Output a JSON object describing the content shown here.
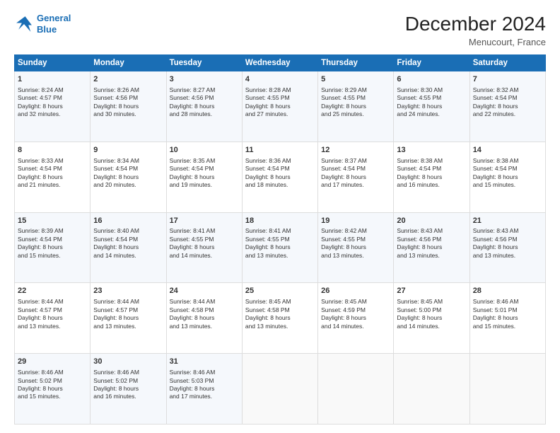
{
  "header": {
    "logo_line1": "General",
    "logo_line2": "Blue",
    "month": "December 2024",
    "location": "Menucourt, France"
  },
  "days_of_week": [
    "Sunday",
    "Monday",
    "Tuesday",
    "Wednesday",
    "Thursday",
    "Friday",
    "Saturday"
  ],
  "weeks": [
    [
      {
        "day": 1,
        "lines": [
          "Sunrise: 8:24 AM",
          "Sunset: 4:57 PM",
          "Daylight: 8 hours",
          "and 32 minutes."
        ]
      },
      {
        "day": 2,
        "lines": [
          "Sunrise: 8:26 AM",
          "Sunset: 4:56 PM",
          "Daylight: 8 hours",
          "and 30 minutes."
        ]
      },
      {
        "day": 3,
        "lines": [
          "Sunrise: 8:27 AM",
          "Sunset: 4:56 PM",
          "Daylight: 8 hours",
          "and 28 minutes."
        ]
      },
      {
        "day": 4,
        "lines": [
          "Sunrise: 8:28 AM",
          "Sunset: 4:55 PM",
          "Daylight: 8 hours",
          "and 27 minutes."
        ]
      },
      {
        "day": 5,
        "lines": [
          "Sunrise: 8:29 AM",
          "Sunset: 4:55 PM",
          "Daylight: 8 hours",
          "and 25 minutes."
        ]
      },
      {
        "day": 6,
        "lines": [
          "Sunrise: 8:30 AM",
          "Sunset: 4:55 PM",
          "Daylight: 8 hours",
          "and 24 minutes."
        ]
      },
      {
        "day": 7,
        "lines": [
          "Sunrise: 8:32 AM",
          "Sunset: 4:54 PM",
          "Daylight: 8 hours",
          "and 22 minutes."
        ]
      }
    ],
    [
      {
        "day": 8,
        "lines": [
          "Sunrise: 8:33 AM",
          "Sunset: 4:54 PM",
          "Daylight: 8 hours",
          "and 21 minutes."
        ]
      },
      {
        "day": 9,
        "lines": [
          "Sunrise: 8:34 AM",
          "Sunset: 4:54 PM",
          "Daylight: 8 hours",
          "and 20 minutes."
        ]
      },
      {
        "day": 10,
        "lines": [
          "Sunrise: 8:35 AM",
          "Sunset: 4:54 PM",
          "Daylight: 8 hours",
          "and 19 minutes."
        ]
      },
      {
        "day": 11,
        "lines": [
          "Sunrise: 8:36 AM",
          "Sunset: 4:54 PM",
          "Daylight: 8 hours",
          "and 18 minutes."
        ]
      },
      {
        "day": 12,
        "lines": [
          "Sunrise: 8:37 AM",
          "Sunset: 4:54 PM",
          "Daylight: 8 hours",
          "and 17 minutes."
        ]
      },
      {
        "day": 13,
        "lines": [
          "Sunrise: 8:38 AM",
          "Sunset: 4:54 PM",
          "Daylight: 8 hours",
          "and 16 minutes."
        ]
      },
      {
        "day": 14,
        "lines": [
          "Sunrise: 8:38 AM",
          "Sunset: 4:54 PM",
          "Daylight: 8 hours",
          "and 15 minutes."
        ]
      }
    ],
    [
      {
        "day": 15,
        "lines": [
          "Sunrise: 8:39 AM",
          "Sunset: 4:54 PM",
          "Daylight: 8 hours",
          "and 15 minutes."
        ]
      },
      {
        "day": 16,
        "lines": [
          "Sunrise: 8:40 AM",
          "Sunset: 4:54 PM",
          "Daylight: 8 hours",
          "and 14 minutes."
        ]
      },
      {
        "day": 17,
        "lines": [
          "Sunrise: 8:41 AM",
          "Sunset: 4:55 PM",
          "Daylight: 8 hours",
          "and 14 minutes."
        ]
      },
      {
        "day": 18,
        "lines": [
          "Sunrise: 8:41 AM",
          "Sunset: 4:55 PM",
          "Daylight: 8 hours",
          "and 13 minutes."
        ]
      },
      {
        "day": 19,
        "lines": [
          "Sunrise: 8:42 AM",
          "Sunset: 4:55 PM",
          "Daylight: 8 hours",
          "and 13 minutes."
        ]
      },
      {
        "day": 20,
        "lines": [
          "Sunrise: 8:43 AM",
          "Sunset: 4:56 PM",
          "Daylight: 8 hours",
          "and 13 minutes."
        ]
      },
      {
        "day": 21,
        "lines": [
          "Sunrise: 8:43 AM",
          "Sunset: 4:56 PM",
          "Daylight: 8 hours",
          "and 13 minutes."
        ]
      }
    ],
    [
      {
        "day": 22,
        "lines": [
          "Sunrise: 8:44 AM",
          "Sunset: 4:57 PM",
          "Daylight: 8 hours",
          "and 13 minutes."
        ]
      },
      {
        "day": 23,
        "lines": [
          "Sunrise: 8:44 AM",
          "Sunset: 4:57 PM",
          "Daylight: 8 hours",
          "and 13 minutes."
        ]
      },
      {
        "day": 24,
        "lines": [
          "Sunrise: 8:44 AM",
          "Sunset: 4:58 PM",
          "Daylight: 8 hours",
          "and 13 minutes."
        ]
      },
      {
        "day": 25,
        "lines": [
          "Sunrise: 8:45 AM",
          "Sunset: 4:58 PM",
          "Daylight: 8 hours",
          "and 13 minutes."
        ]
      },
      {
        "day": 26,
        "lines": [
          "Sunrise: 8:45 AM",
          "Sunset: 4:59 PM",
          "Daylight: 8 hours",
          "and 14 minutes."
        ]
      },
      {
        "day": 27,
        "lines": [
          "Sunrise: 8:45 AM",
          "Sunset: 5:00 PM",
          "Daylight: 8 hours",
          "and 14 minutes."
        ]
      },
      {
        "day": 28,
        "lines": [
          "Sunrise: 8:46 AM",
          "Sunset: 5:01 PM",
          "Daylight: 8 hours",
          "and 15 minutes."
        ]
      }
    ],
    [
      {
        "day": 29,
        "lines": [
          "Sunrise: 8:46 AM",
          "Sunset: 5:02 PM",
          "Daylight: 8 hours",
          "and 15 minutes."
        ]
      },
      {
        "day": 30,
        "lines": [
          "Sunrise: 8:46 AM",
          "Sunset: 5:02 PM",
          "Daylight: 8 hours",
          "and 16 minutes."
        ]
      },
      {
        "day": 31,
        "lines": [
          "Sunrise: 8:46 AM",
          "Sunset: 5:03 PM",
          "Daylight: 8 hours",
          "and 17 minutes."
        ]
      },
      null,
      null,
      null,
      null
    ]
  ]
}
